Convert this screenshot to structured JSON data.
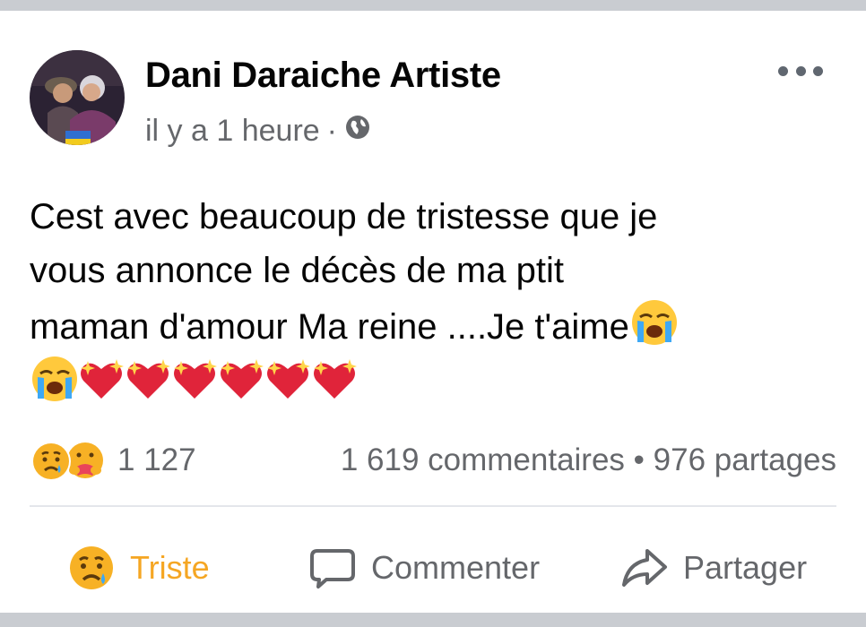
{
  "post": {
    "author": "Dani Daraiche Artiste",
    "time": "il y a 1 heure",
    "separator": "·",
    "audience_icon": "globe-icon",
    "text_line_1": "Cest avec beaucoup de tristesse que je",
    "text_line_2": "vous annonce le décès de ma ptit",
    "text_line_3": "maman d'amour  Ma reine ....Je t'aime",
    "emojis": [
      "loudly-crying-face",
      "loudly-crying-face",
      "sparkling-heart",
      "sparkling-heart",
      "sparkling-heart",
      "sparkling-heart",
      "sparkling-heart",
      "sparkling-heart"
    ]
  },
  "stats": {
    "reactions_icons": [
      "sad-reaction-icon",
      "care-reaction-icon"
    ],
    "reactions_count": "1 127",
    "comments": "1 619 commentaires",
    "bullet": "•",
    "shares": "976 partages"
  },
  "actions": {
    "react_label": "Triste",
    "comment_label": "Commenter",
    "share_label": "Partager"
  },
  "colors": {
    "reaction_active": "#f5a623",
    "secondary_text": "#65676b",
    "primary_text": "#050505",
    "background": "#c9ccd1"
  }
}
